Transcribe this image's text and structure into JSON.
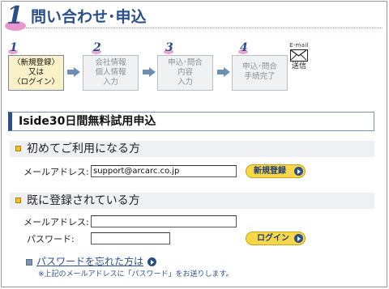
{
  "page": {
    "number": "1",
    "title": "問い合わせ･申込"
  },
  "steps": [
    {
      "number": "1",
      "lines": [
        "〈新規登録〉",
        "又は",
        "〈ログイン〉"
      ],
      "active": true
    },
    {
      "number": "2",
      "lines": [
        "会社情報",
        "個人情報",
        "入力"
      ],
      "active": false
    },
    {
      "number": "3",
      "lines": [
        "申込･問合",
        "内容",
        "入力"
      ],
      "active": false
    },
    {
      "number": "4",
      "lines": [
        "申込･問合",
        "手続完了"
      ],
      "active": false
    }
  ],
  "email_step": {
    "label": "E-mail",
    "sublabel": "送信",
    "icon": "envelope-icon"
  },
  "section": {
    "title": "Iside30日間無料試用申込"
  },
  "new_user": {
    "heading": "初めてご利用になる方",
    "email_label": "メールアドレス:",
    "email_value": "support@arcarc.co.jp",
    "button_label": "新規登録"
  },
  "existing_user": {
    "heading": "既に登録されている方",
    "email_label": "メールアドレス:",
    "email_value": "",
    "password_label": "パスワード:",
    "password_value": "",
    "button_label": "ログイン"
  },
  "forgot": {
    "link_label": "パスワードを忘れた方は",
    "note": "※上記のメールアドレスに「パスワード」をお送りします。"
  },
  "colors": {
    "accent": "#2a4f8a",
    "button_yellow": "#f7d64a",
    "active_step": "#fbf1c9",
    "pink": "#e27cc0"
  }
}
